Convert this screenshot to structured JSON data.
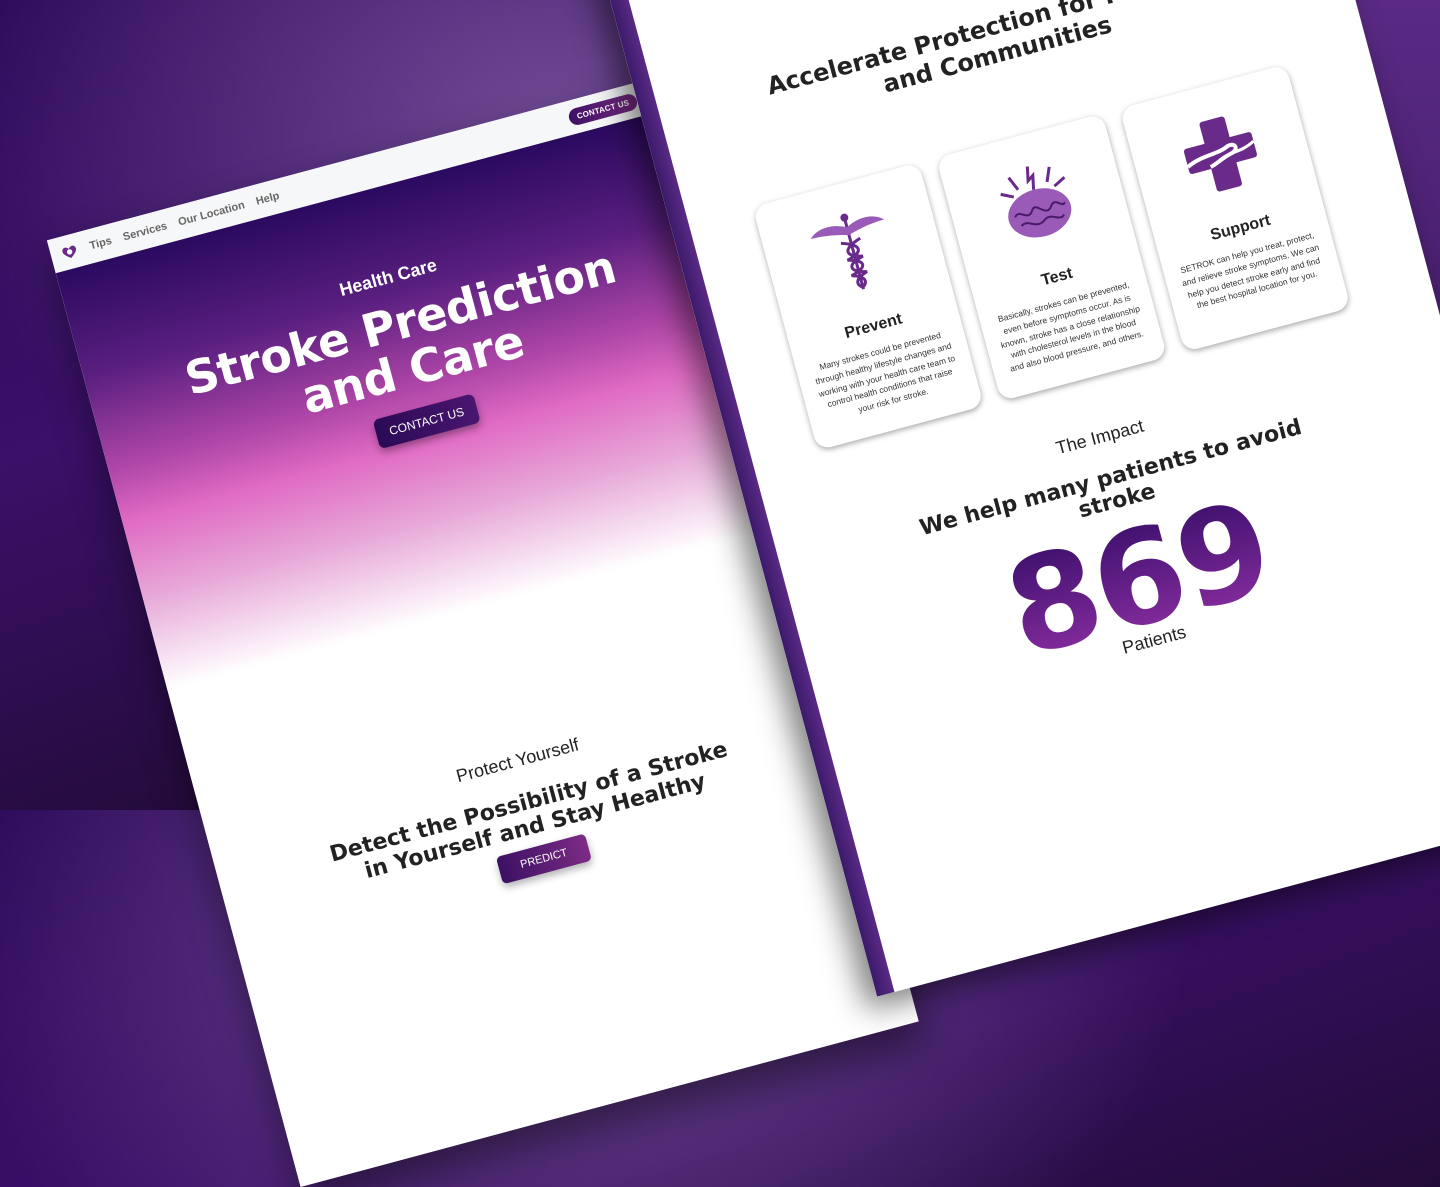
{
  "colors": {
    "accent_dark": "#2a0a55",
    "accent": "#7d2b86",
    "hero_pink": "#e06bc4"
  },
  "left_page": {
    "nav": {
      "logo_icon": "heart-hands-icon",
      "links": [
        "Tips",
        "Services",
        "Our Location",
        "Help"
      ],
      "contact_label": "CONTACT US",
      "search_icon": "search-icon"
    },
    "hero": {
      "eyebrow": "Health Care",
      "title_line1": "Stroke Prediction",
      "title_line2": "and Care",
      "cta_label": "CONTACT US"
    },
    "protect": {
      "eyebrow": "Protect Yourself",
      "title_line1": "Detect the Possibility of a Stroke",
      "title_line2": "in Yourself and Stay Healthy",
      "cta_label": "PREDICT"
    }
  },
  "right_page": {
    "section_title_line1": "Accelerate Protection for Patients",
    "section_title_line2": "and Communities",
    "cards": [
      {
        "icon": "caduceus-icon",
        "name": "Prevent",
        "desc": "Many strokes could be prevented through healthy lifestyle changes and working with your health care team to control health conditions that raise your risk for stroke."
      },
      {
        "icon": "brain-icon",
        "name": "Test",
        "desc": "Basically, strokes can be prevented, even before symptoms occur. As is known, stroke has a close relationship with cholesterol levels in the blood and also blood pressure, and others."
      },
      {
        "icon": "medical-cross-hands-icon",
        "name": "Support",
        "desc": "SETROK can help you treat, protect, and relieve stroke symptoms. We can help you detect stroke early and find the best hospital location for you."
      }
    ],
    "impact": {
      "eyebrow": "The Impact",
      "title_line1": "We help many patients to avoid",
      "title_line2": "stroke",
      "count": "869",
      "unit": "Patients"
    }
  }
}
